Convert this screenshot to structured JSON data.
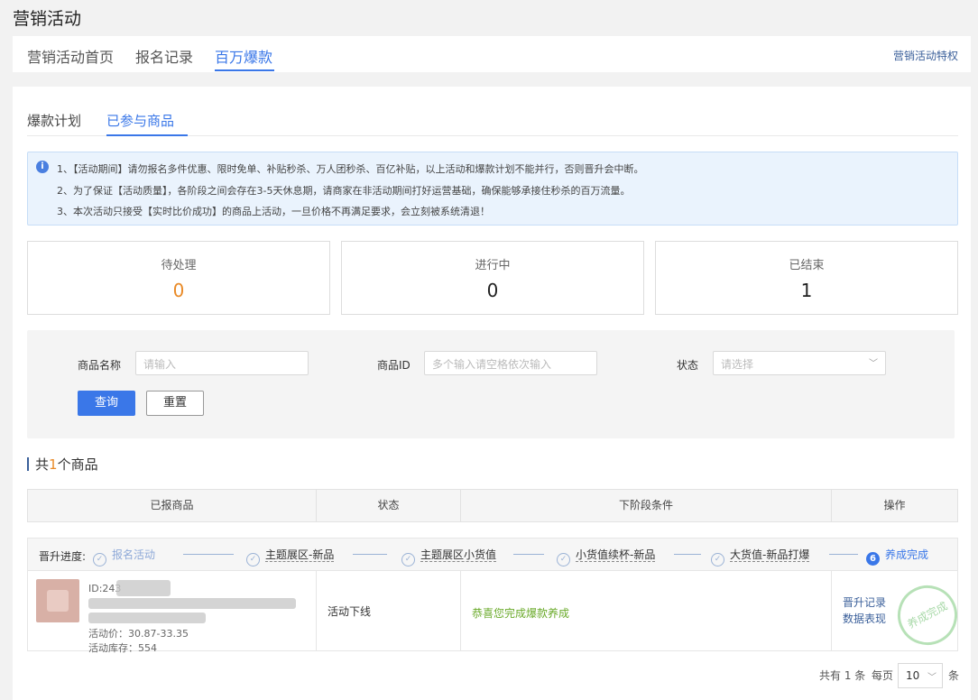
{
  "page_title": "营销活动",
  "top_tabs": [
    "营销活动首页",
    "报名记录",
    "百万爆款"
  ],
  "top_active": "百万爆款",
  "privilege_link": "营销活动特权",
  "sub_tabs": [
    "爆款计划",
    "已参与商品"
  ],
  "notice": {
    "icon": "info-icon",
    "lines": [
      "1、【活动期间】请勿报名多件优惠、限时免单、补贴秒杀、万人团秒杀、百亿补贴，以上活动和爆款计划不能并行，否则晋升会中断。",
      "2、为了保证【活动质量】，各阶段之间会存在3-5天休息期，请商家在非活动期间打好运营基础，确保能够承接住秒杀的百万流量。",
      "3、本次活动只接受【实时比价成功】的商品上活动，一旦价格不再满足要求，会立刻被系统清退！"
    ]
  },
  "stats": [
    {
      "label": "待处理",
      "value": "0"
    },
    {
      "label": "进行中",
      "value": "0"
    },
    {
      "label": "已结束",
      "value": "1"
    }
  ],
  "filter": {
    "name_label": "商品名称",
    "name_placeholder": "请输入",
    "id_label": "商品ID",
    "id_placeholder": "多个输入请空格依次输入",
    "status_label": "状态",
    "status_placeholder": "请选择",
    "query_button": "查询",
    "reset_button": "重置"
  },
  "count": {
    "prefix": "共",
    "num": "1",
    "suffix": "个商品"
  },
  "table": {
    "headers": [
      "已报商品",
      "状态",
      "下阶段条件",
      "操作"
    ]
  },
  "progress": {
    "label": "晋升进度:",
    "steps": [
      "报名活动",
      "主题展区-新品",
      "主题展区小货值",
      "小货值续杯-新品",
      "大货值-新品打爆",
      "养成完成"
    ],
    "current_step_number": "6"
  },
  "row": {
    "id": "ID:243",
    "price": "活动价：30.87-33.35",
    "stock": "活动库存：554",
    "status": "活动下线",
    "condition": "恭喜您完成爆款养成",
    "ops": [
      "晋升记录",
      "数据表现"
    ],
    "stamp": "养成完成"
  },
  "pager": {
    "total_text": "共有 1 条",
    "per_page_label": "每页",
    "page_size": "10",
    "unit": "条"
  }
}
